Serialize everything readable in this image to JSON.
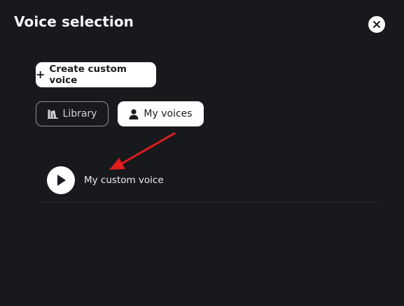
{
  "header": {
    "title": "Voice selection",
    "close_icon": "close-icon"
  },
  "actions": {
    "create_label": "Create custom voice",
    "create_icon": "plus-icon"
  },
  "tabs": [
    {
      "label": "Library",
      "icon": "library-icon",
      "active": false
    },
    {
      "label": "My voices",
      "icon": "user-icon",
      "active": true
    }
  ],
  "voices": [
    {
      "name": "My custom voice",
      "icon": "play-icon"
    }
  ],
  "annotation": {
    "icon": "arrow-icon",
    "color": "#e11d1d"
  },
  "colors": {
    "background": "#18191d",
    "surface": "#ffffff",
    "text": "#f5f5f7"
  }
}
